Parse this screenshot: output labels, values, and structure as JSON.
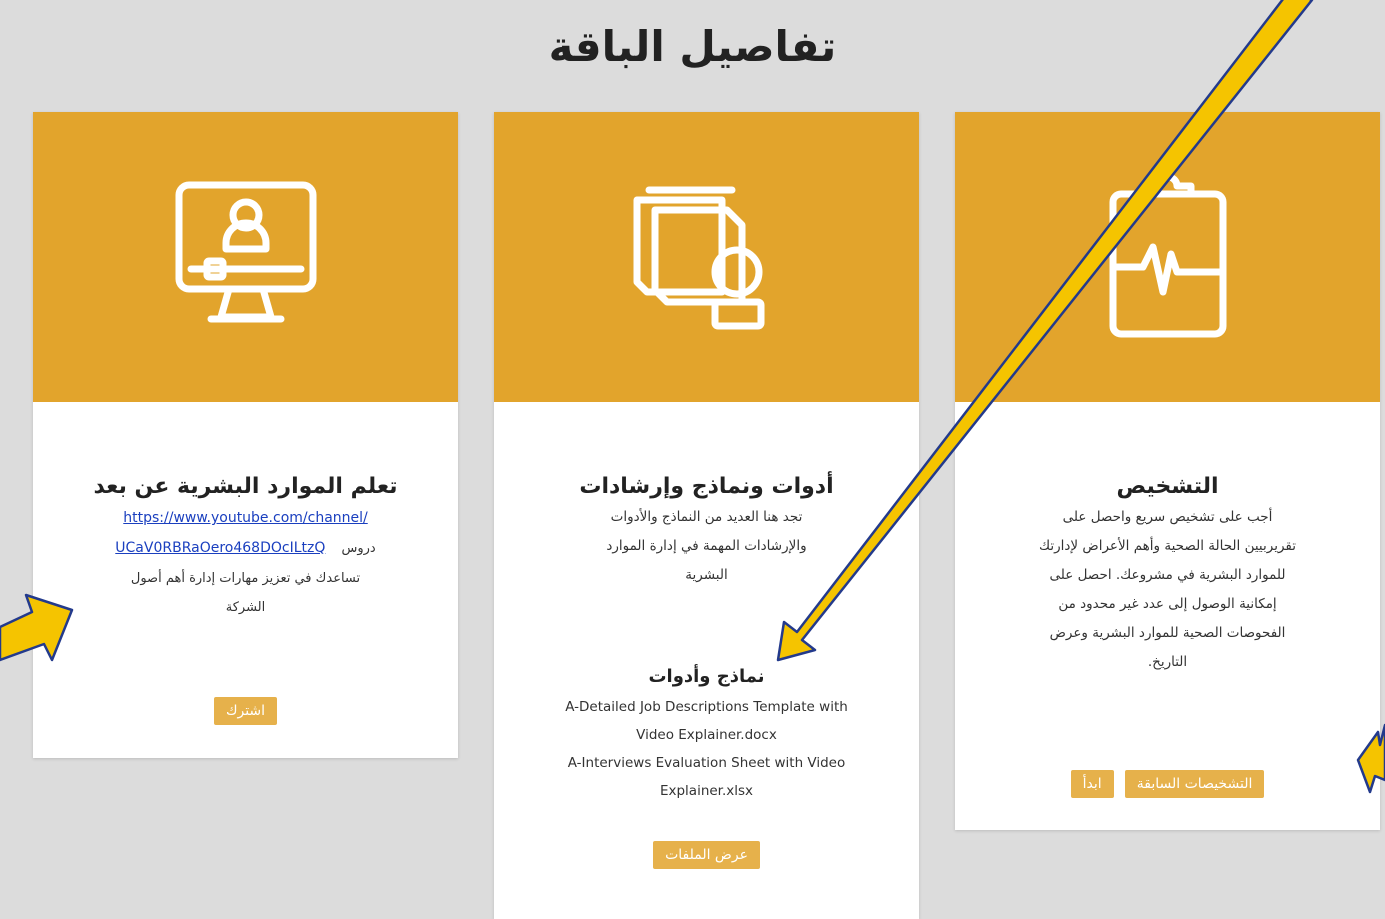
{
  "page": {
    "title": "تفاصيل الباقة"
  },
  "cards": {
    "diagnosis": {
      "icon": "clipboard-heartbeat-icon",
      "title": "التشخيص",
      "desc": "أجب على تشخيص سريع واحصل على تقريربيين الحالة الصحية وأهم الأعراض لإدارتك للموارد البشرية في مشروعك. احصل على إمكانية الوصول إلى عدد غير محدود من الفحوصات الصحية للموارد البشرية وعرض التاريخ.",
      "buttons": {
        "previous": "التشخيصات السابقة",
        "start": "ابدأ"
      }
    },
    "tools": {
      "icon": "documents-user-icon",
      "title": "أدوات ونماذج وإرشادات",
      "desc": "تجد هنا العديد من النماذج والأدوات والإرشادات المهمة في إدارة الموارد البشرية",
      "section_title": "نماذج وأدوات",
      "files": [
        "A-Detailed Job Descriptions Template with Video Explainer.docx",
        "A-Interviews Evaluation Sheet with Video Explainer.xlsx"
      ],
      "button": "عرض الملفات"
    },
    "learning": {
      "icon": "monitor-user-icon",
      "title": "تعلم الموارد البشرية عن بعد",
      "link_line1": "https://www.youtube.com/channel/",
      "link_line2": "UCaV0RBRaOero468DOcILtzQ",
      "prefix": "دروس",
      "desc": "تساعدك في تعزيز مهارات إدارة أهم أصول الشركة",
      "button": "اشترك"
    }
  },
  "colors": {
    "accent": "#e2a42c",
    "button": "#e6b14b",
    "arrow_fill": "#f5c400",
    "arrow_stroke": "#233a8c"
  }
}
